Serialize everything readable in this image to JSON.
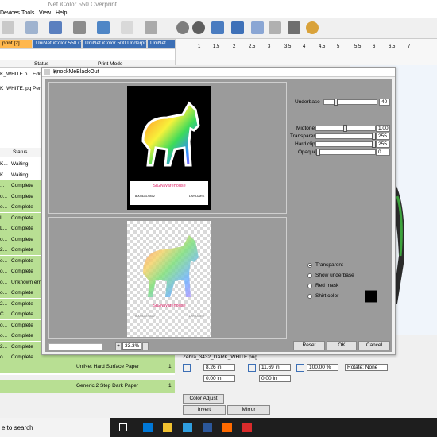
{
  "window": {
    "title": "...Net iColor 550 Overprint"
  },
  "menu": [
    "Devices",
    "Tools",
    "View",
    "Help"
  ],
  "tabs": [
    "print [2]",
    "UniNet iColor 550 CMYK [1]",
    "UniNet iColor 500 Underprint",
    "UniNet i"
  ],
  "top_table": {
    "headers": [
      "Status",
      "Print Mode"
    ],
    "rows": [
      {
        "name": "K_WHITE.p...",
        "status": "Edit"
      },
      {
        "name": "K_WHITE.jpg",
        "status": "Pen"
      }
    ]
  },
  "queue": {
    "header": "Status",
    "rows": [
      {
        "name": "K...",
        "status": "Waiting",
        "color": "white"
      },
      {
        "name": "K...",
        "status": "Waiting",
        "color": "white"
      },
      {
        "name": "...",
        "status": "Complete",
        "color": "green"
      },
      {
        "name": "o...",
        "status": "Complete",
        "color": "green"
      },
      {
        "name": "o...",
        "status": "Complete",
        "color": "green"
      },
      {
        "name": "L...",
        "status": "Complete",
        "color": "green"
      },
      {
        "name": "L...",
        "status": "Complete",
        "color": "green"
      },
      {
        "name": "o...",
        "status": "Complete",
        "color": "green"
      },
      {
        "name": "2...",
        "status": "Complete",
        "color": "green"
      },
      {
        "name": "o...",
        "status": "Complete",
        "color": "green"
      },
      {
        "name": "o...",
        "status": "Complete",
        "color": "green"
      },
      {
        "name": "o...",
        "status": "Unknown erro",
        "color": "green"
      },
      {
        "name": "o...",
        "status": "Complete",
        "color": "green"
      },
      {
        "name": "2...",
        "status": "Complete",
        "color": "green"
      },
      {
        "name": "C...",
        "status": "Complete",
        "color": "green"
      },
      {
        "name": "o...",
        "status": "Complete",
        "color": "green"
      },
      {
        "name": "o...",
        "status": "Complete",
        "color": "green"
      },
      {
        "name": "2...",
        "status": "Complete",
        "color": "green"
      },
      {
        "name": "o...",
        "status": "Complete",
        "color": "green"
      }
    ],
    "paper_labels": [
      "UniNet Hard Surface Paper",
      "Generic 2 Step Dark Paper"
    ],
    "paper_counts": [
      "1",
      "1"
    ]
  },
  "ruler_numbers": [
    "1",
    "1.5",
    "2",
    "2.5",
    "3",
    "3.5",
    "4",
    "4.5",
    "5",
    "5.5",
    "6",
    "6.5",
    "7"
  ],
  "dialog": {
    "title": "KnockMeBlackOut",
    "close": "✕",
    "underbase_label": "Underbase",
    "underbase_value": "40",
    "sliders": [
      {
        "label": "Midtones",
        "value": "1.00"
      },
      {
        "label": "Transparent",
        "value": "255"
      },
      {
        "label": "Hard clip",
        "value": "255"
      },
      {
        "label": "Opaque",
        "value": "0"
      }
    ],
    "radios": [
      {
        "label": "Transparent",
        "selected": true
      },
      {
        "label": "Show underbase",
        "selected": false
      },
      {
        "label": "Red mask",
        "selected": false
      },
      {
        "label": "Shirt color",
        "selected": false
      }
    ],
    "zoom": "33.3%",
    "zoom_plus": "+",
    "zoom_minus": "-",
    "buttons": {
      "reset": "Reset",
      "ok": "OK",
      "cancel": "Cancel"
    },
    "tshirt_brand": "SIGNWarehouse",
    "tshirt_phone": "800-523-9852",
    "tshirt_tag": "LAY DARK"
  },
  "bottom": {
    "filename": "Zebra_3432_DARK_WHITE.png",
    "width": "8.26 in",
    "height": "11.69 in",
    "scale": "100.00 %",
    "rotate": "Rotate: None",
    "x_offset": "0.00 in",
    "y_offset": "0.00 in",
    "color_adjust": "Color Adjust",
    "invert": "Invert",
    "mirror": "Mirror"
  },
  "taskbar": {
    "search": "e to search"
  },
  "colors": {
    "green": "#b8df93",
    "tab": "#3c6fb5",
    "taskbar": "#1e1e1e"
  }
}
